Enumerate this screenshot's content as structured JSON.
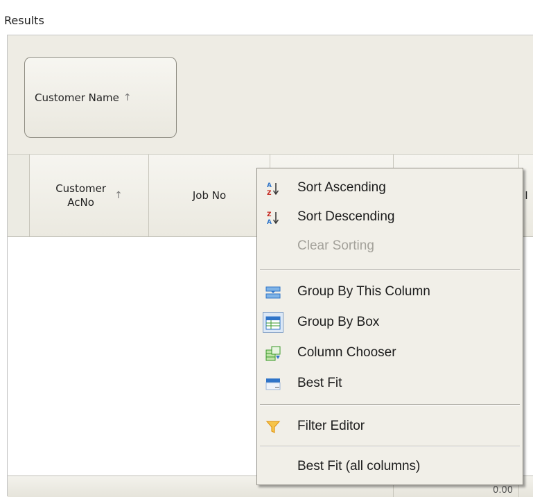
{
  "results": {
    "title": "Results"
  },
  "group_panel": {
    "group_box_label": "Customer Name",
    "sort_arrow": "↑"
  },
  "grid": {
    "columns": [
      {
        "label_line1": "Customer",
        "label_line2": "AcNo",
        "sort_arrow": "↑"
      },
      {
        "label": "Job No"
      },
      {
        "label": ""
      },
      {
        "label": ""
      },
      {
        "label": "I"
      }
    ],
    "footer_value": "0.00"
  },
  "context_menu": {
    "items": [
      {
        "label": "Sort Ascending",
        "icon": "sort-ascending-icon"
      },
      {
        "label": "Sort Descending",
        "icon": "sort-descending-icon"
      },
      {
        "label": "Clear Sorting",
        "icon": "",
        "disabled": true
      },
      {
        "label": "Group By This Column",
        "icon": "group-by-column-icon"
      },
      {
        "label": "Group By Box",
        "icon": "group-by-box-icon"
      },
      {
        "label": "Column Chooser",
        "icon": "column-chooser-icon"
      },
      {
        "label": "Best Fit",
        "icon": "best-fit-icon"
      },
      {
        "label": "Filter Editor",
        "icon": "filter-icon"
      },
      {
        "label": "Best Fit (all columns)",
        "icon": ""
      }
    ]
  },
  "colors": {
    "panel_background": "#eeece4",
    "menu_background": "#f1efe8",
    "menu_border": "#8f8d85",
    "disabled_text": "#a3a19a",
    "icon_blue": "#2f74c8",
    "icon_red": "#c4241c",
    "icon_green": "#3a9a2a",
    "filter_orange": "#e39a1b"
  }
}
